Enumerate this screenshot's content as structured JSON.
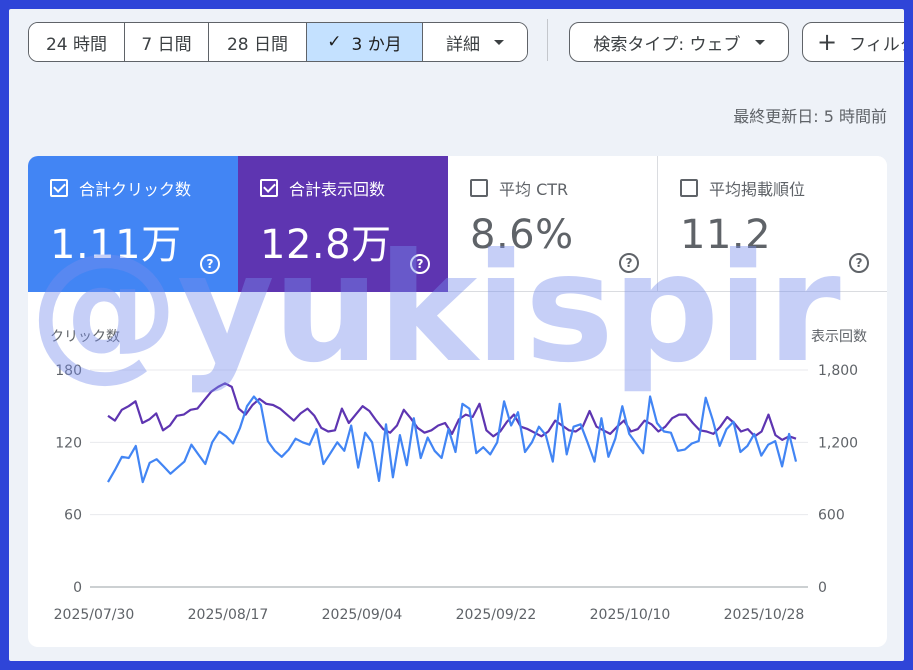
{
  "toolbar": {
    "ranges": [
      {
        "label": "24 時間"
      },
      {
        "label": "7 日間"
      },
      {
        "label": "28 日間"
      },
      {
        "label": "3 か月",
        "active": true
      },
      {
        "label": "詳細"
      }
    ],
    "check_icon": "check-icon",
    "search_type": "検索タイプ: ウェブ",
    "filter_label": "フィルタ"
  },
  "last_updated": "最終更新日: 5 時間前",
  "metrics": [
    {
      "label": "合計クリック数",
      "value": "1.11万",
      "checked": true,
      "color": "#4285f4"
    },
    {
      "label": "合計表示回数",
      "value": "12.8万",
      "checked": true,
      "color": "#5e35b1"
    },
    {
      "label": "平均 CTR",
      "value": "8.6%",
      "checked": false
    },
    {
      "label": "平均掲載順位",
      "value": "11.2",
      "checked": false
    }
  ],
  "help_mark": "?",
  "watermark": "@yukispir",
  "chart_data": {
    "type": "line",
    "left_axis_label": "クリック数",
    "right_axis_label": "表示回数",
    "x_ticks": [
      "2025/07/30",
      "2025/08/17",
      "2025/09/04",
      "2025/09/22",
      "2025/10/10",
      "2025/10/28"
    ],
    "y_left_ticks": [
      "180",
      "120",
      "60",
      "0"
    ],
    "y_right_ticks": [
      "1,800",
      "1,200",
      "600",
      "0"
    ],
    "ylim_left": [
      0,
      180
    ],
    "ylim_right": [
      0,
      1800
    ],
    "series": [
      {
        "name": "クリック数",
        "axis": "left",
        "color": "#4285f4",
        "values": [
          87,
          97,
          108,
          107,
          117,
          87,
          103,
          106,
          100,
          94,
          99,
          104,
          118,
          110,
          102,
          120,
          129,
          125,
          119,
          132,
          150,
          158,
          151,
          121,
          113,
          108,
          114,
          123,
          120,
          118,
          131,
          102,
          111,
          120,
          113,
          134,
          99,
          128,
          120,
          88,
          135,
          91,
          126,
          101,
          140,
          107,
          124,
          113,
          107,
          131,
          112,
          152,
          148,
          111,
          116,
          110,
          120,
          154,
          134,
          145,
          112,
          120,
          133,
          126,
          104,
          152,
          110,
          133,
          135,
          120,
          104,
          140,
          108,
          123,
          150,
          127,
          119,
          111,
          158,
          136,
          129,
          128,
          113,
          114,
          119,
          121,
          157,
          139,
          117,
          131,
          137,
          112,
          117,
          127,
          109,
          118,
          121,
          100,
          127,
          104
        ]
      },
      {
        "name": "表示回数",
        "axis": "right",
        "color": "#5e35b1",
        "values": [
          1420,
          1380,
          1470,
          1500,
          1540,
          1360,
          1390,
          1440,
          1300,
          1340,
          1420,
          1430,
          1470,
          1480,
          1550,
          1620,
          1660,
          1690,
          1660,
          1480,
          1430,
          1510,
          1560,
          1520,
          1510,
          1480,
          1430,
          1380,
          1440,
          1480,
          1420,
          1320,
          1290,
          1300,
          1480,
          1360,
          1430,
          1500,
          1460,
          1380,
          1310,
          1280,
          1340,
          1470,
          1400,
          1320,
          1280,
          1300,
          1340,
          1360,
          1270,
          1390,
          1430,
          1410,
          1520,
          1300,
          1250,
          1290,
          1370,
          1430,
          1330,
          1310,
          1280,
          1250,
          1290,
          1380,
          1340,
          1300,
          1290,
          1330,
          1460,
          1330,
          1300,
          1270,
          1330,
          1380,
          1290,
          1310,
          1380,
          1350,
          1290,
          1330,
          1400,
          1430,
          1430,
          1360,
          1300,
          1290,
          1270,
          1330,
          1410,
          1360,
          1290,
          1310,
          1250,
          1290,
          1430,
          1260,
          1220,
          1250,
          1230
        ]
      }
    ]
  }
}
